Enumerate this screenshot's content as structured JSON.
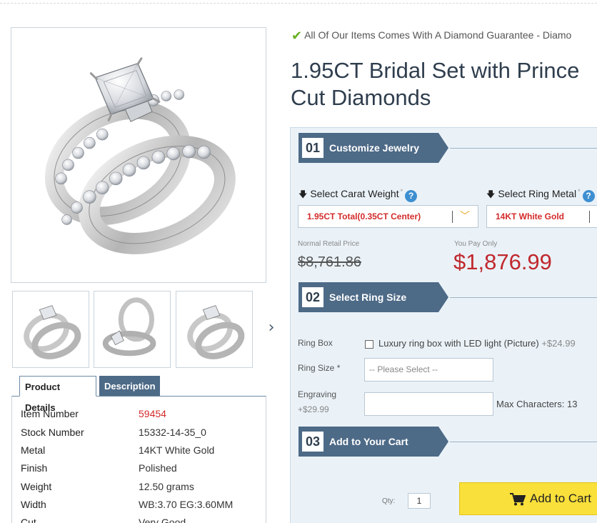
{
  "guarantee": {
    "text": "All Of Our Items Comes With A Diamond Guarantee - Diamo"
  },
  "product": {
    "title_line1": "1.95CT Bridal Set with Prince",
    "title_line2": "Cut Diamonds"
  },
  "tabs": [
    {
      "label": "Product Details",
      "active": true
    },
    {
      "label": "Description",
      "active": false
    }
  ],
  "details": [
    {
      "label": "Item Number",
      "value": "59454"
    },
    {
      "label": "Stock Number",
      "value": "15332-14-35_0"
    },
    {
      "label": "Metal",
      "value": "14KT White Gold"
    },
    {
      "label": "Finish",
      "value": "Polished"
    },
    {
      "label": "Weight",
      "value": "12.50 grams"
    },
    {
      "label": "Width",
      "value": "WB:3.70 EG:3.60MM"
    },
    {
      "label": "Cut",
      "value": "Very Good"
    }
  ],
  "steps": [
    {
      "num": "01",
      "label": "Customize Jewelry"
    },
    {
      "num": "02",
      "label": "Select Ring Size"
    },
    {
      "num": "03",
      "label": "Add to Your Cart"
    }
  ],
  "carat": {
    "label": "Select Carat Weight",
    "required_mark": "*",
    "help": "?",
    "value": "1.95CT Total(0.35CT Center)"
  },
  "metal": {
    "label": "Select Ring Metal",
    "required_mark": "*",
    "help": "?",
    "value": "14KT White Gold"
  },
  "pricing": {
    "retail_label": "Normal Retail Price",
    "retail_price": "$8,761.86",
    "pay_label": "You Pay Only",
    "pay_price": "$1,876.99"
  },
  "ring_box": {
    "label": "Ring Box",
    "option_text": "Luxury ring box with LED light (Picture)",
    "option_price": "+$24.99"
  },
  "ring_size": {
    "label": "Ring Size *",
    "placeholder": "-- Please Select --"
  },
  "engraving": {
    "label": "Engraving",
    "price": "+$29.99",
    "max_chars": "Max Characters: 13"
  },
  "cart": {
    "qty_label": "Qty:",
    "qty_value": "1",
    "button_label": "Add to Cart"
  },
  "colors": {
    "step_bg": "#4d6a87",
    "config_bg": "#eaf2f8",
    "price_red": "#c0282d",
    "cart_yellow": "#f9e03a",
    "check_green": "#6ab024"
  },
  "icons": [
    "check-icon",
    "help-icon",
    "down-arrow-icon",
    "chevron-down-icon",
    "chevron-right-icon",
    "cart-icon"
  ]
}
